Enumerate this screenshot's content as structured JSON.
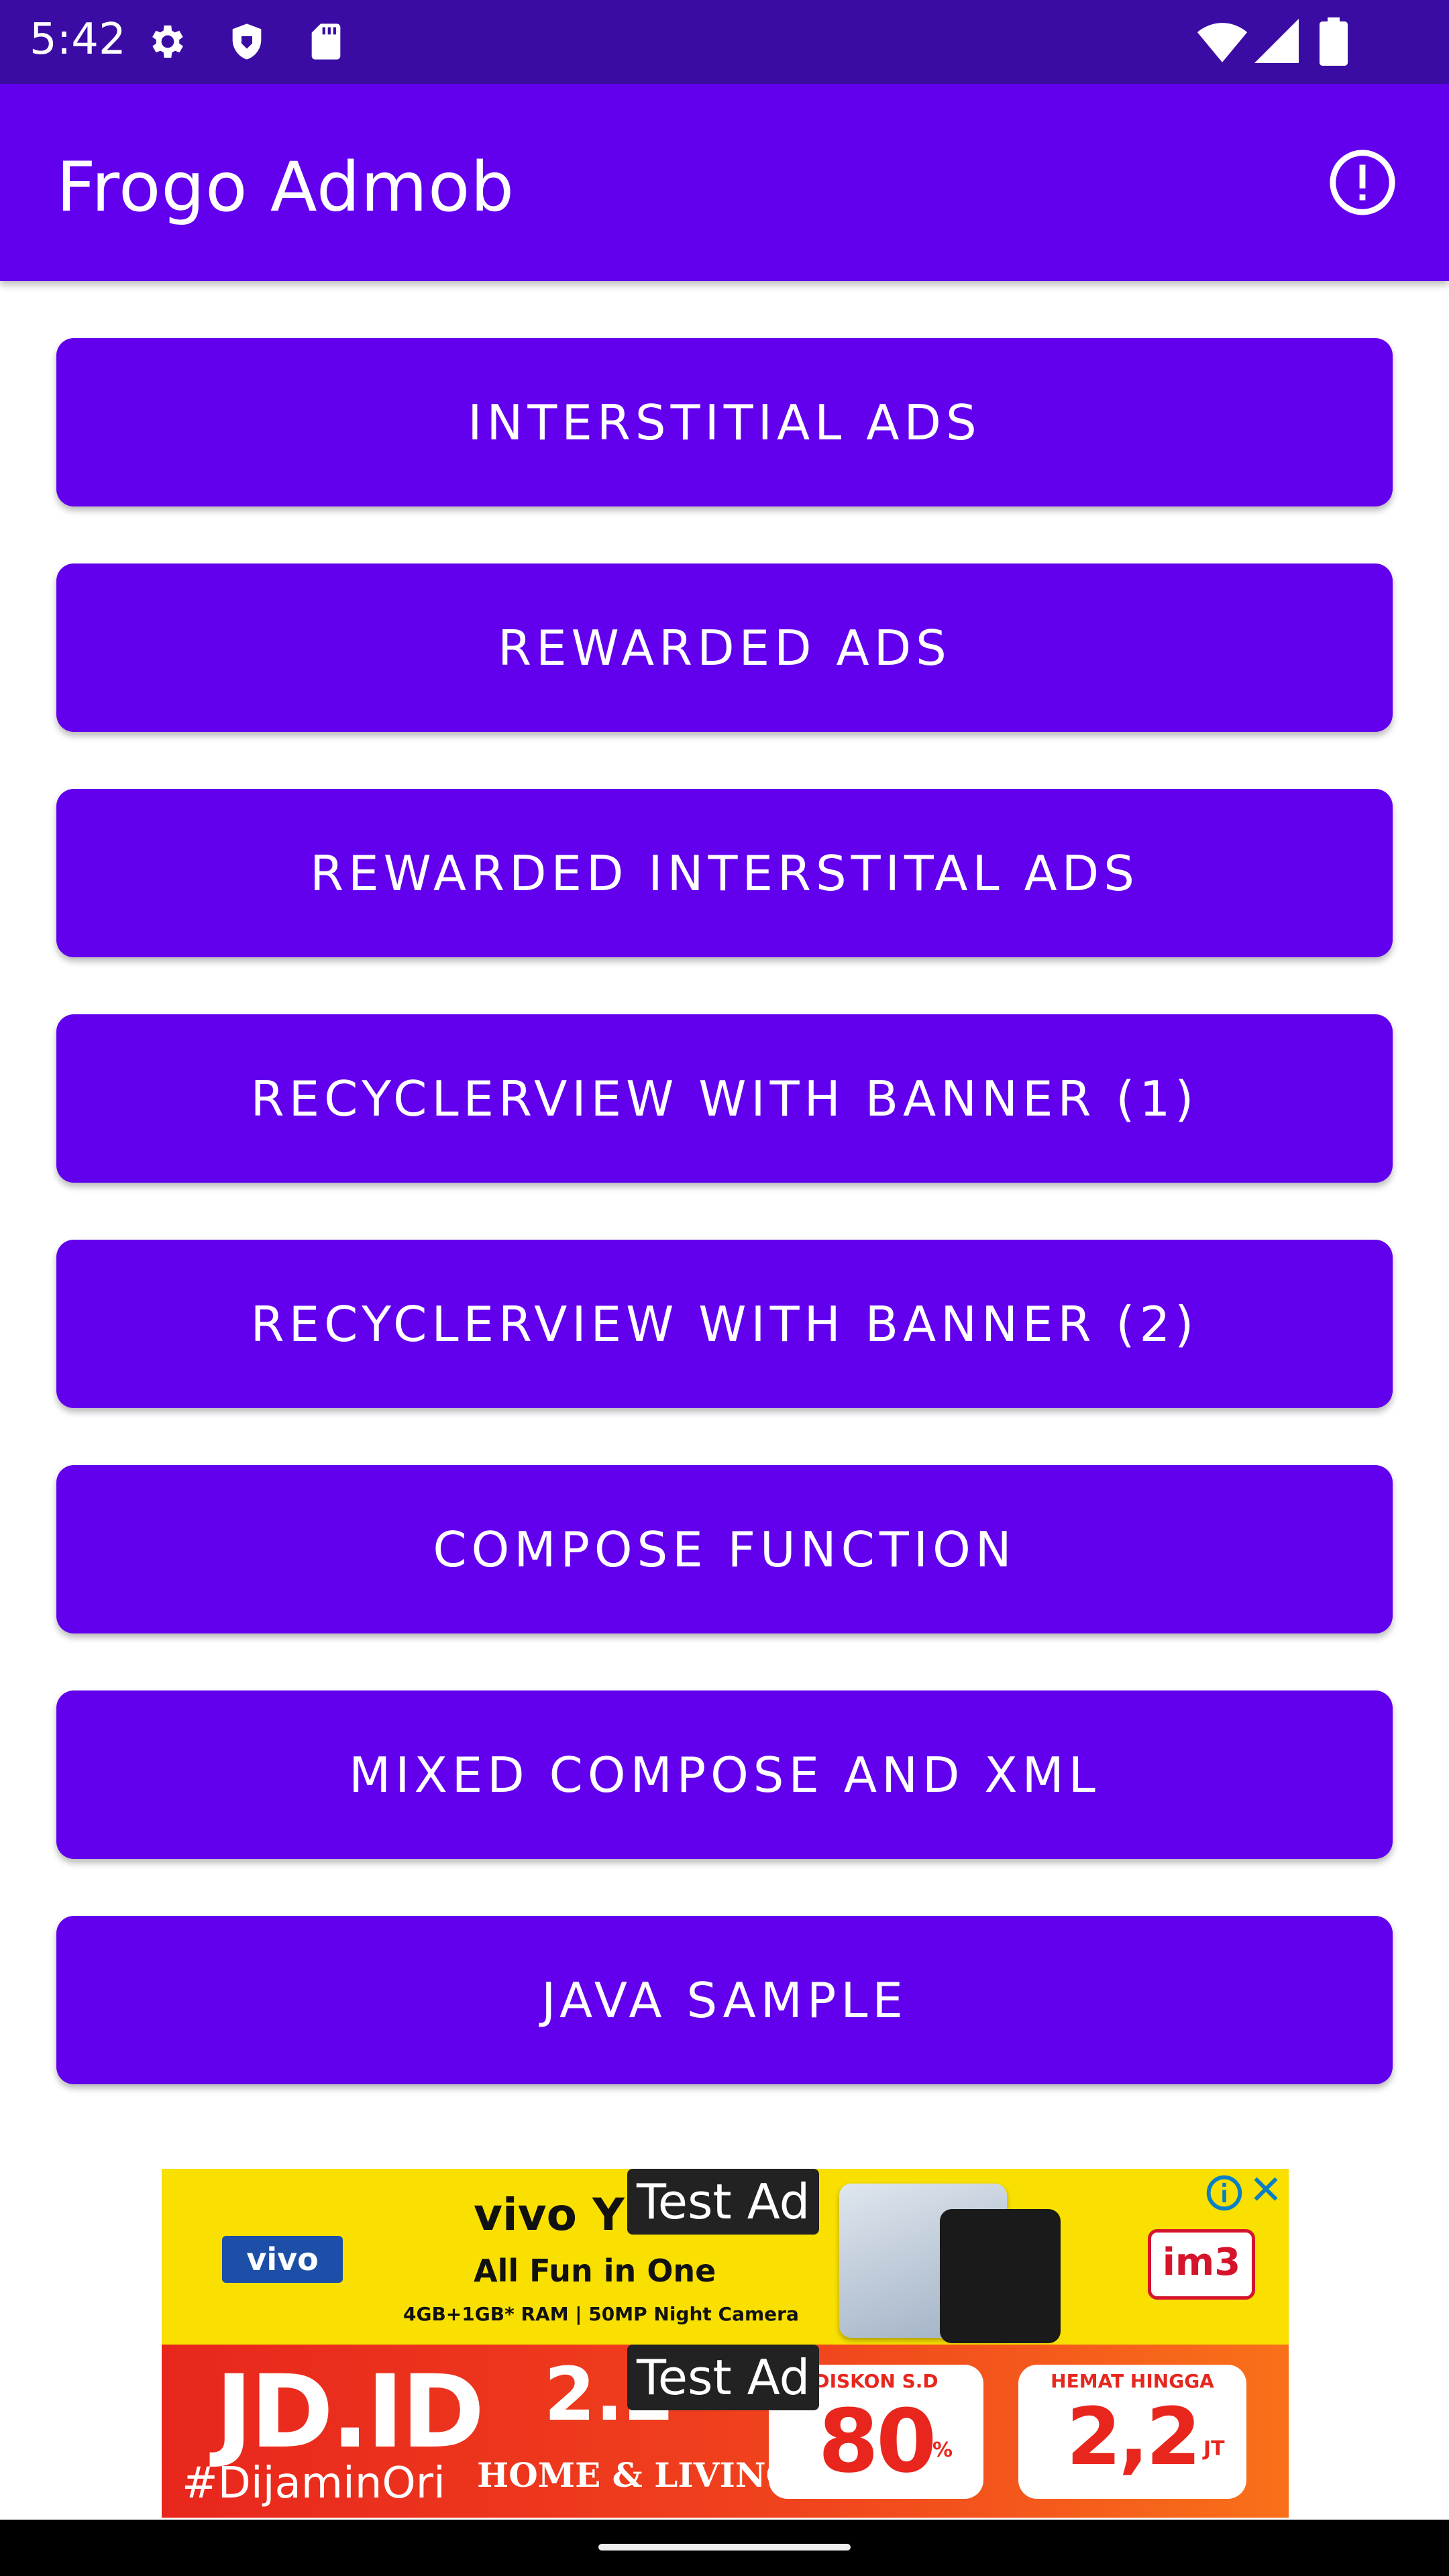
{
  "status_bar": {
    "time": "5:42",
    "left_icons": [
      "settings-icon",
      "shield-icon",
      "sd-card-icon"
    ],
    "right_icons": [
      "wifi-icon",
      "signal-icon",
      "battery-icon"
    ]
  },
  "app_bar": {
    "title": "Frogo Admob",
    "action_icon": "info-icon"
  },
  "buttons": [
    {
      "label": "INTERSTITIAL ADS"
    },
    {
      "label": "REWARDED ADS"
    },
    {
      "label": "REWARDED INTERSTITAL ADS"
    },
    {
      "label": "RECYCLERVIEW WITH BANNER (1)"
    },
    {
      "label": "RECYCLERVIEW WITH BANNER (2)"
    },
    {
      "label": "COMPOSE FUNCTION"
    },
    {
      "label": "MIXED COMPOSE AND XML"
    },
    {
      "label": "JAVA SAMPLE"
    }
  ],
  "ad_banner_top": {
    "badge": "Test Ad",
    "brand": "vivo",
    "headline": "vivo Y",
    "subline": "All Fun in One",
    "spec": "4GB+1GB* RAM | 50MP Night Camera",
    "partner": "im3"
  },
  "ad_banner_bottom": {
    "badge": "Test Ad",
    "logo": "JD.ID",
    "hashtag": "#DijaminOri",
    "event_number": "2.2",
    "event_name": "HOME & LIVING",
    "promo1_label": "DISKON S.D",
    "promo1_value": "80",
    "promo1_unit": "%",
    "promo2_label": "HEMAT HINGGA",
    "promo2_value": "2,2",
    "promo2_unit": "JT"
  },
  "colors": {
    "status_bar": "#3a0ca3",
    "primary": "#6200ee",
    "on_primary": "#ffffff"
  }
}
